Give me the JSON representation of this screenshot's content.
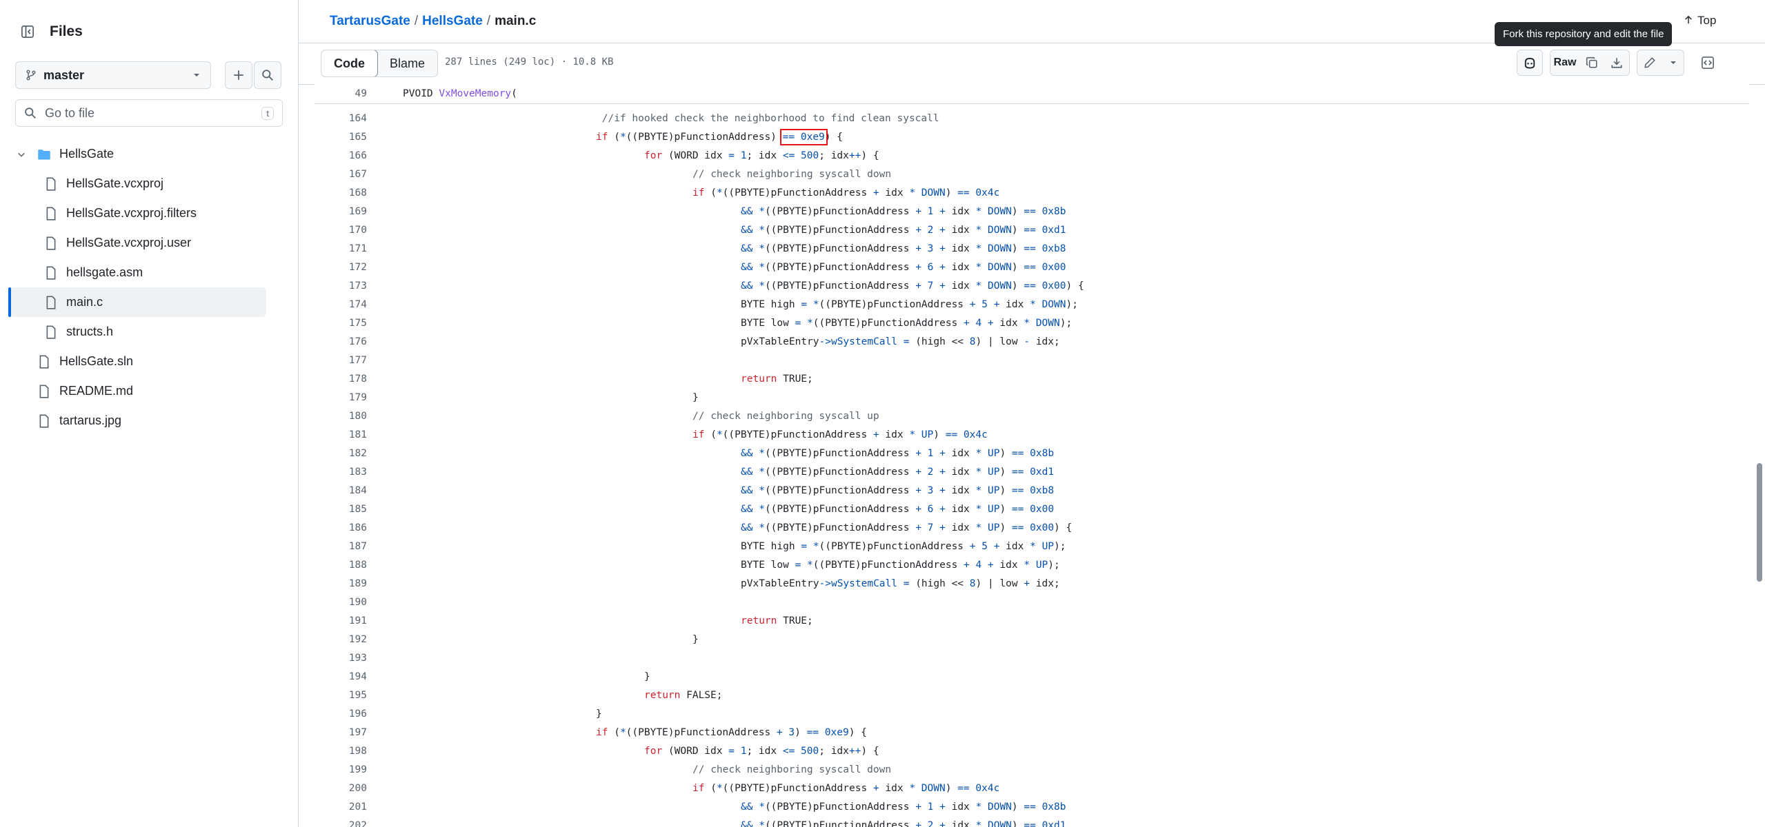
{
  "sidebar": {
    "title": "Files",
    "branch": "master",
    "goto_placeholder": "Go to file",
    "goto_shortcut": "t",
    "tree": [
      {
        "label": "HellsGate",
        "type": "folder",
        "level": 1,
        "expanded": true
      },
      {
        "label": "HellsGate.vcxproj",
        "type": "file",
        "level": 2
      },
      {
        "label": "HellsGate.vcxproj.filters",
        "type": "file",
        "level": 2
      },
      {
        "label": "HellsGate.vcxproj.user",
        "type": "file",
        "level": 2
      },
      {
        "label": "hellsgate.asm",
        "type": "file",
        "level": 2
      },
      {
        "label": "main.c",
        "type": "file",
        "level": 2,
        "selected": true
      },
      {
        "label": "structs.h",
        "type": "file",
        "level": 2
      },
      {
        "label": "HellsGate.sln",
        "type": "file",
        "level": 1
      },
      {
        "label": "README.md",
        "type": "file",
        "level": 1
      },
      {
        "label": "tartarus.jpg",
        "type": "file",
        "level": 1
      }
    ]
  },
  "header": {
    "breadcrumb": {
      "repo": "TartarusGate",
      "folder": "HellsGate",
      "file": "main.c"
    },
    "tooltip": "Fork this repository and edit the file",
    "top_label": "Top"
  },
  "toolbar": {
    "code_tab": "Code",
    "blame_tab": "Blame",
    "meta": "287 lines (249 loc) · 10.8 KB",
    "raw_label": "Raw"
  },
  "code": {
    "sticky_line": {
      "num": "49",
      "text": "PVOID VxMoveMemory("
    },
    "lines": [
      {
        "num": "164",
        "indent": 4,
        "text": " //if hooked check the neighborhood to find clean syscall"
      },
      {
        "num": "165",
        "indent": 4,
        "text": "if (*((PBYTE)pFunctionAddress) == 0xe9) {"
      },
      {
        "num": "166",
        "indent": 5,
        "text": "for (WORD idx = 1; idx <= 500; idx++) {"
      },
      {
        "num": "167",
        "indent": 6,
        "text": "// check neighboring syscall down"
      },
      {
        "num": "168",
        "indent": 6,
        "text": "if (*((PBYTE)pFunctionAddress + idx * DOWN) == 0x4c"
      },
      {
        "num": "169",
        "indent": 7,
        "text": "&& *((PBYTE)pFunctionAddress + 1 + idx * DOWN) == 0x8b"
      },
      {
        "num": "170",
        "indent": 7,
        "text": "&& *((PBYTE)pFunctionAddress + 2 + idx * DOWN) == 0xd1"
      },
      {
        "num": "171",
        "indent": 7,
        "text": "&& *((PBYTE)pFunctionAddress + 3 + idx * DOWN) == 0xb8"
      },
      {
        "num": "172",
        "indent": 7,
        "text": "&& *((PBYTE)pFunctionAddress + 6 + idx * DOWN) == 0x00"
      },
      {
        "num": "173",
        "indent": 7,
        "text": "&& *((PBYTE)pFunctionAddress + 7 + idx * DOWN) == 0x00) {"
      },
      {
        "num": "174",
        "indent": 7,
        "text": "BYTE high = *((PBYTE)pFunctionAddress + 5 + idx * DOWN);"
      },
      {
        "num": "175",
        "indent": 7,
        "text": "BYTE low = *((PBYTE)pFunctionAddress + 4 + idx * DOWN);"
      },
      {
        "num": "176",
        "indent": 7,
        "text": "pVxTableEntry->wSystemCall = (high << 8) | low - idx;"
      },
      {
        "num": "177",
        "indent": 0,
        "text": ""
      },
      {
        "num": "178",
        "indent": 7,
        "text": "return TRUE;"
      },
      {
        "num": "179",
        "indent": 6,
        "text": "}"
      },
      {
        "num": "180",
        "indent": 6,
        "text": "// check neighboring syscall up"
      },
      {
        "num": "181",
        "indent": 6,
        "text": "if (*((PBYTE)pFunctionAddress + idx * UP) == 0x4c"
      },
      {
        "num": "182",
        "indent": 7,
        "text": "&& *((PBYTE)pFunctionAddress + 1 + idx * UP) == 0x8b"
      },
      {
        "num": "183",
        "indent": 7,
        "text": "&& *((PBYTE)pFunctionAddress + 2 + idx * UP) == 0xd1"
      },
      {
        "num": "184",
        "indent": 7,
        "text": "&& *((PBYTE)pFunctionAddress + 3 + idx * UP) == 0xb8"
      },
      {
        "num": "185",
        "indent": 7,
        "text": "&& *((PBYTE)pFunctionAddress + 6 + idx * UP) == 0x00"
      },
      {
        "num": "186",
        "indent": 7,
        "text": "&& *((PBYTE)pFunctionAddress + 7 + idx * UP) == 0x00) {"
      },
      {
        "num": "187",
        "indent": 7,
        "text": "BYTE high = *((PBYTE)pFunctionAddress + 5 + idx * UP);"
      },
      {
        "num": "188",
        "indent": 7,
        "text": "BYTE low = *((PBYTE)pFunctionAddress + 4 + idx * UP);"
      },
      {
        "num": "189",
        "indent": 7,
        "text": "pVxTableEntry->wSystemCall = (high << 8) | low + idx;"
      },
      {
        "num": "190",
        "indent": 0,
        "text": ""
      },
      {
        "num": "191",
        "indent": 7,
        "text": "return TRUE;"
      },
      {
        "num": "192",
        "indent": 6,
        "text": "}"
      },
      {
        "num": "193",
        "indent": 0,
        "text": ""
      },
      {
        "num": "194",
        "indent": 5,
        "text": "}"
      },
      {
        "num": "195",
        "indent": 5,
        "text": "return FALSE;"
      },
      {
        "num": "196",
        "indent": 4,
        "text": "}"
      },
      {
        "num": "197",
        "indent": 4,
        "text": "if (*((PBYTE)pFunctionAddress + 3) == 0xe9) {"
      },
      {
        "num": "198",
        "indent": 5,
        "text": "for (WORD idx = 1; idx <= 500; idx++) {"
      },
      {
        "num": "199",
        "indent": 6,
        "text": "// check neighboring syscall down"
      },
      {
        "num": "200",
        "indent": 6,
        "text": "if (*((PBYTE)pFunctionAddress + idx * DOWN) == 0x4c"
      },
      {
        "num": "201",
        "indent": 7,
        "text": "&& *((PBYTE)pFunctionAddress + 1 + idx * DOWN) == 0x8b"
      },
      {
        "num": "202",
        "indent": 7,
        "text": "&& *((PBYTE)pFunctionAddress + 2 + idx * DOWN) == 0xd1"
      }
    ]
  },
  "colors": {
    "link": "#0969da",
    "keyword": "#cf222e",
    "number": "#0550ae",
    "comment": "#59636e",
    "highlight_box": "#e5141b"
  }
}
